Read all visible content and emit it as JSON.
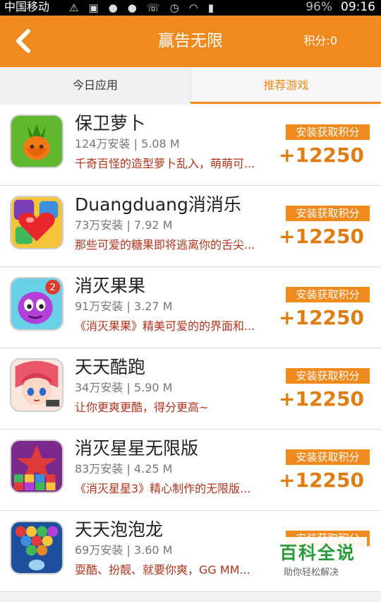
{
  "status_bar": {
    "carrier": "中国移动",
    "battery": "96%",
    "time": "09:16",
    "icons": [
      "warning-icon",
      "image-icon",
      "wechat-icon",
      "wechat-icon",
      "call-icon",
      "alarm-icon",
      "wifi-icon",
      "signal-icon"
    ]
  },
  "header": {
    "title": "赢告无限",
    "points": "积分:0",
    "accent": "#f08a1c"
  },
  "tabs": [
    {
      "label": "今日应用",
      "selected": false
    },
    {
      "label": "推荐游戏",
      "selected": true
    }
  ],
  "apps": [
    {
      "name": "保卫萝卜",
      "meta": "124万安装 | 5.08 M",
      "desc": "千奇百怪的造型萝卜乱入，萌萌可...",
      "badge": "安装获取积分",
      "points": "+12250",
      "icon": "carrot-game-icon"
    },
    {
      "name": "Duangduang消消乐",
      "meta": "73万安装 | 7.92 M",
      "desc": "那些可爱的糖果即将逃离你的舌尖...",
      "badge": "安装获取积分",
      "points": "+12250",
      "icon": "candy-heart-icon"
    },
    {
      "name": "消灭果果",
      "meta": "91万安装 | 3.27 M",
      "desc": "《消灭果果》精美可爱的的界面和...",
      "badge": "安装获取积分",
      "points": "+12250",
      "icon": "purple-fruit-icon",
      "icon_badge": "2"
    },
    {
      "name": "天天酷跑",
      "meta": "34万安装 | 5.90 M",
      "desc": "让你更爽更酷，得分更高~",
      "badge": "安装获取积分",
      "points": "+12250",
      "icon": "runner-girl-icon"
    },
    {
      "name": "消灭星星无限版",
      "meta": "83万安装 | 4.25 M",
      "desc": "《消灭星星3》精心制作的无限版...",
      "badge": "安装获取积分",
      "points": "+12250",
      "icon": "star-blocks-icon"
    },
    {
      "name": "天天泡泡龙",
      "meta": "69万安装 | 3.60 M",
      "desc": "耍酷、扮靓、就要你爽，GG MM...",
      "badge": "安装获取积分",
      "points": "",
      "icon": "bubble-shooter-icon"
    }
  ],
  "watermark": {
    "title": "百科全说",
    "subtitle": "助你轻松解决"
  }
}
